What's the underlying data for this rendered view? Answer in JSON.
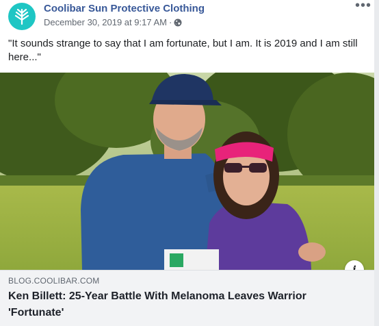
{
  "post": {
    "page_name": "Coolibar Sun Protective Clothing",
    "date": "December 30, 2019 at 9:17 AM",
    "separator": "·",
    "privacy_icon": "globe-icon",
    "more_label": "•••",
    "text": "\"It sounds strange to say that I am fortunate, but I am. It is 2019 and I am still here...\""
  },
  "link": {
    "domain": "BLOG.COOLIBAR.COM",
    "headline": "Ken Billett: 25-Year Battle With Melanoma Leaves Warrior 'Fortunate'",
    "info_label": "i"
  },
  "colors": {
    "brand_teal": "#1ec6c4",
    "page_name_blue": "#385898",
    "meta_gray": "#606770",
    "link_bg": "#f2f3f5"
  }
}
